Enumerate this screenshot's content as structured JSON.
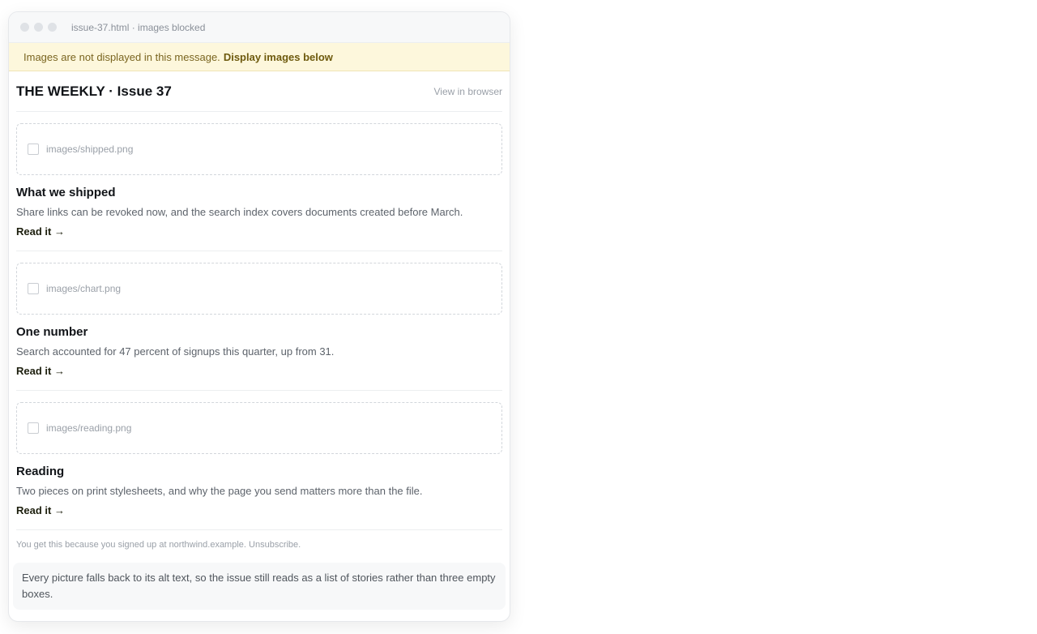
{
  "window": {
    "title": "issue-37.html · images blocked"
  },
  "banner": {
    "text": "Images are not displayed in this message.",
    "link": "Display images below"
  },
  "header": {
    "brand": "THE WEEKLY · Issue 37",
    "view_in_browser": "View in browser"
  },
  "stories": [
    {
      "image_alt": "images/shipped.png",
      "title": "What we shipped",
      "body": "Share links can be revoked now, and the search index covers documents created before March.",
      "link": "Read it →"
    },
    {
      "image_alt": "images/chart.png",
      "title": "One number",
      "body": "Search accounted for 47 percent of signups this quarter, up from 31.",
      "link": "Read it →"
    },
    {
      "image_alt": "images/reading.png",
      "title": "Reading",
      "body": "Two pieces on print stylesheets, and why the page you send matters more than the file.",
      "link": "Read it →"
    }
  ],
  "footer": {
    "text": "You get this because you signed up at northwind.example.",
    "unsubscribe": "Unsubscribe."
  },
  "note": "Every picture falls back to its alt text, so the issue still reads as a list of stories rather than three empty boxes."
}
